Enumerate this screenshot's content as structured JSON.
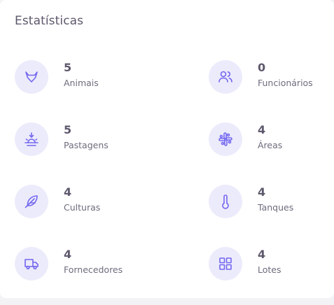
{
  "title": "Estatísticas",
  "accent_color": "#7367f0",
  "icon_bg_color": "#ecebfb",
  "stats": [
    {
      "value": "5",
      "label": "Animais",
      "icon": "gitlab-fox-icon"
    },
    {
      "value": "0",
      "label": "Funcionários",
      "icon": "users-icon"
    },
    {
      "value": "5",
      "label": "Pastagens",
      "icon": "sunrise-icon"
    },
    {
      "value": "4",
      "label": "Áreas",
      "icon": "slack-icon"
    },
    {
      "value": "4",
      "label": "Culturas",
      "icon": "feather-icon"
    },
    {
      "value": "4",
      "label": "Tanques",
      "icon": "thermometer-icon"
    },
    {
      "value": "4",
      "label": "Fornecedores",
      "icon": "truck-icon"
    },
    {
      "value": "4",
      "label": "Lotes",
      "icon": "grid-icon"
    }
  ]
}
